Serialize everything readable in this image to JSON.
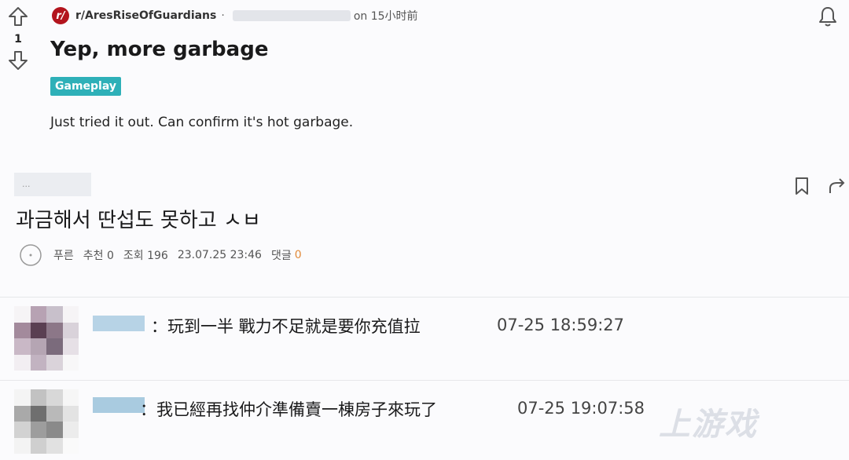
{
  "post": {
    "vote_count": "1",
    "subreddit": "r/AresRiseOfGuardians",
    "separator": "·",
    "time": "on 15小时前",
    "title": "Yep, more garbage",
    "flair": "Gameplay",
    "body": "Just tried it out. Can confirm it's hot garbage."
  },
  "board": {
    "nick_hint": "...",
    "title": "과금해서 딴섭도 못하고 ㅅㅂ",
    "meta": {
      "author": "푸른",
      "likes": "추천 0",
      "views": "조회 196",
      "date": "23.07.25 23:46",
      "comments_label": "댓글",
      "comments_count": "0"
    }
  },
  "chats": [
    {
      "text": "：玩到一半 戰力不足就是要你充值拉",
      "time": "07-25 18:59:27"
    },
    {
      "text": "：我已經再找仲介準備賣一棟房子來玩了",
      "time": "07-25 19:07:58"
    }
  ],
  "watermark": "上游戏"
}
